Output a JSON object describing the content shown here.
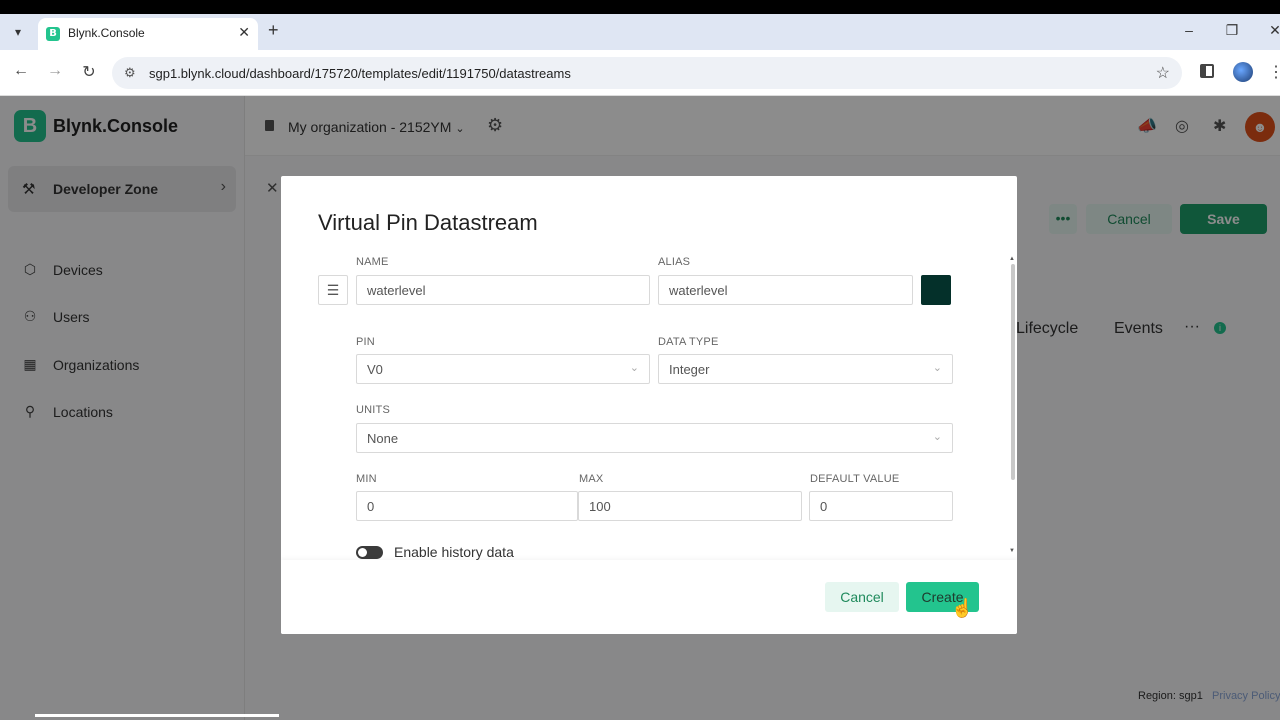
{
  "browser": {
    "tab_title": "Blynk.Console",
    "favicon_letter": "B",
    "url": "sgp1.blynk.cloud/dashboard/175720/templates/edit/1191750/datastreams"
  },
  "app": {
    "logo_letter": "B",
    "logo_text": "Blynk.Console",
    "organization": "My organization - 2152YM",
    "sidebar": {
      "developer_zone": "Developer Zone",
      "items": [
        {
          "label": "Devices",
          "icon": "cube-icon"
        },
        {
          "label": "Users",
          "icon": "users-icon"
        },
        {
          "label": "Organizations",
          "icon": "building-icon"
        },
        {
          "label": "Locations",
          "icon": "pin-icon"
        }
      ]
    },
    "page": {
      "more_label": "•••",
      "cancel_label": "Cancel",
      "save_label": "Save",
      "tabs": [
        "Lifecycle",
        "Events"
      ],
      "tab_more": "···",
      "info_glyph": "i"
    },
    "footer": {
      "region": "Region: sgp1",
      "privacy": "Privacy Policy"
    }
  },
  "modal": {
    "title": "Virtual Pin Datastream",
    "name_label": "NAME",
    "name_value": "waterlevel",
    "alias_label": "ALIAS",
    "alias_value": "waterlevel",
    "color": "#04302a",
    "pin_label": "PIN",
    "pin_value": "V0",
    "data_type_label": "DATA TYPE",
    "data_type_value": "Integer",
    "units_label": "UNITS",
    "units_value": "None",
    "min_label": "MIN",
    "min_value": "0",
    "max_label": "MAX",
    "max_value": "100",
    "default_label": "DEFAULT VALUE",
    "default_value": "0",
    "history_label": "Enable history data",
    "history_enabled": false,
    "cancel_label": "Cancel",
    "create_label": "Create"
  },
  "colors": {
    "accent": "#23c48e",
    "save": "#1e9e6a"
  }
}
